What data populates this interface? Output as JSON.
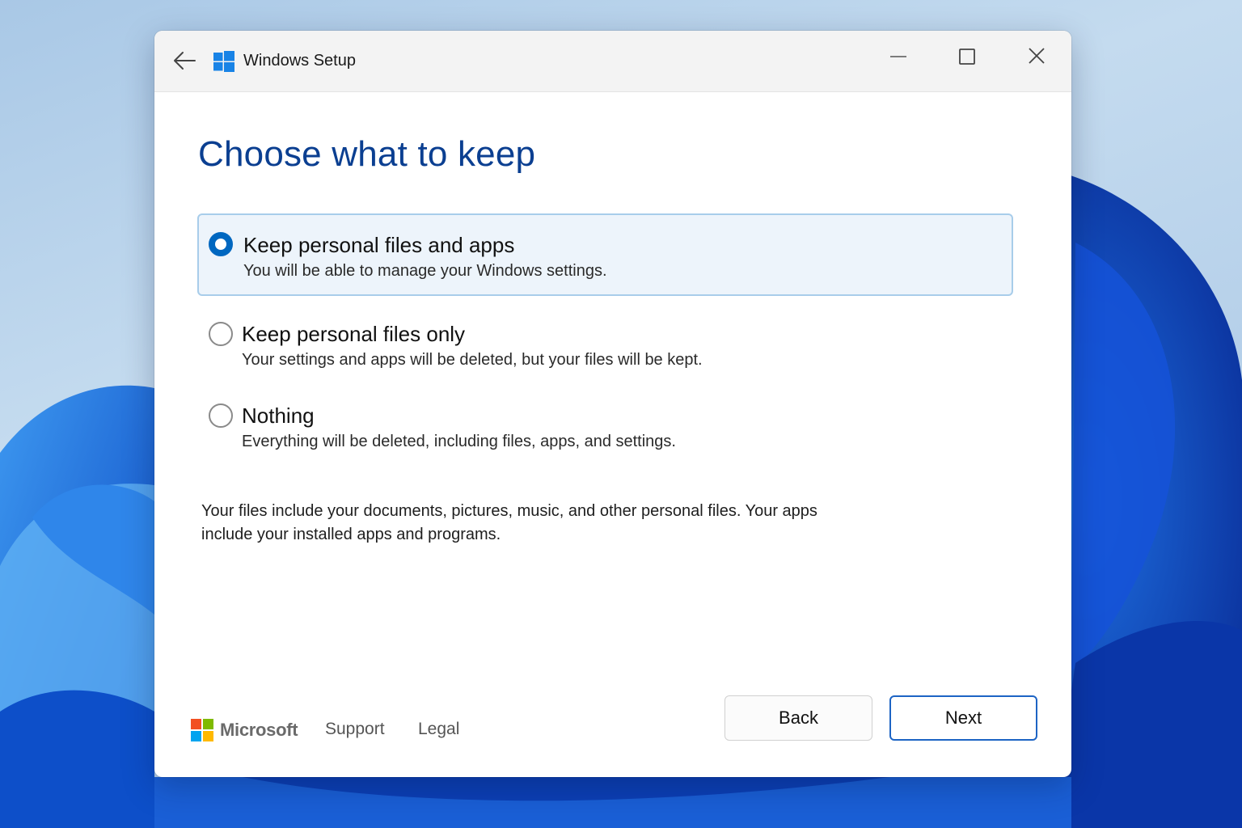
{
  "window": {
    "title": "Windows Setup"
  },
  "page": {
    "heading": "Choose what to keep",
    "options": [
      {
        "label": "Keep personal files and apps",
        "description": "You will be able to manage your Windows settings.",
        "selected": true
      },
      {
        "label": "Keep personal files only",
        "description": "Your settings and apps will be deleted, but your files will be kept.",
        "selected": false
      },
      {
        "label": "Nothing",
        "description": "Everything will be deleted, including files, apps, and settings.",
        "selected": false
      }
    ],
    "info_line1": "Your files include your documents, pictures, music, and other personal files. Your apps",
    "info_line2": "include your installed apps and programs."
  },
  "footer": {
    "brand": "Microsoft",
    "support": "Support",
    "legal": "Legal",
    "back_label": "Back",
    "next_label": "Next"
  },
  "icons": {
    "back": "arrow-left-icon",
    "app": "windows-logo-icon",
    "minimize": "minimize-icon",
    "maximize": "maximize-icon",
    "close": "close-icon",
    "brand": "microsoft-logo-icon"
  },
  "colors": {
    "heading": "#0b3f91",
    "accent": "#0067c0",
    "selected_bg": "#edf4fb",
    "selected_border": "#a8cdea",
    "next_border": "#1d64c4"
  }
}
